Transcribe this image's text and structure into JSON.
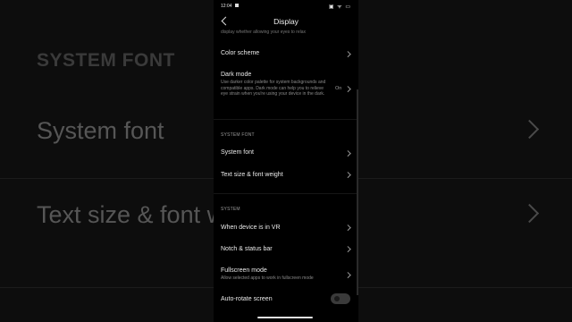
{
  "background": {
    "section_header": "SYSTEM FONT",
    "items": [
      "System font",
      "Text size & font w"
    ]
  },
  "status_bar": {
    "time": "12:04",
    "icons": "▣ ᯤ ▭"
  },
  "header": {
    "title": "Display"
  },
  "partial_text": "display whether allowing your eyes to relax",
  "rows": {
    "color_scheme": "Color scheme",
    "dark_mode": {
      "label": "Dark mode",
      "description": "Use darker color palette for system backgrounds and compatible apps. Dark mode can help you to relieve eye strain when you're using your device in the dark.",
      "value": "On"
    },
    "system_font": "System font",
    "text_size": "Text size & font weight",
    "vr": "When device is in VR",
    "notch": "Notch & status bar",
    "fullscreen": {
      "label": "Fullscreen mode",
      "description": "Allow selected apps to work in fullscreen mode"
    },
    "auto_rotate": {
      "label": "Auto-rotate screen",
      "enabled": false
    }
  },
  "sections": {
    "system_font": "SYSTEM FONT",
    "system": "SYSTEM"
  },
  "colors": {
    "background": "#000000",
    "text": "#eaeaea",
    "muted": "#8a8a8a"
  }
}
